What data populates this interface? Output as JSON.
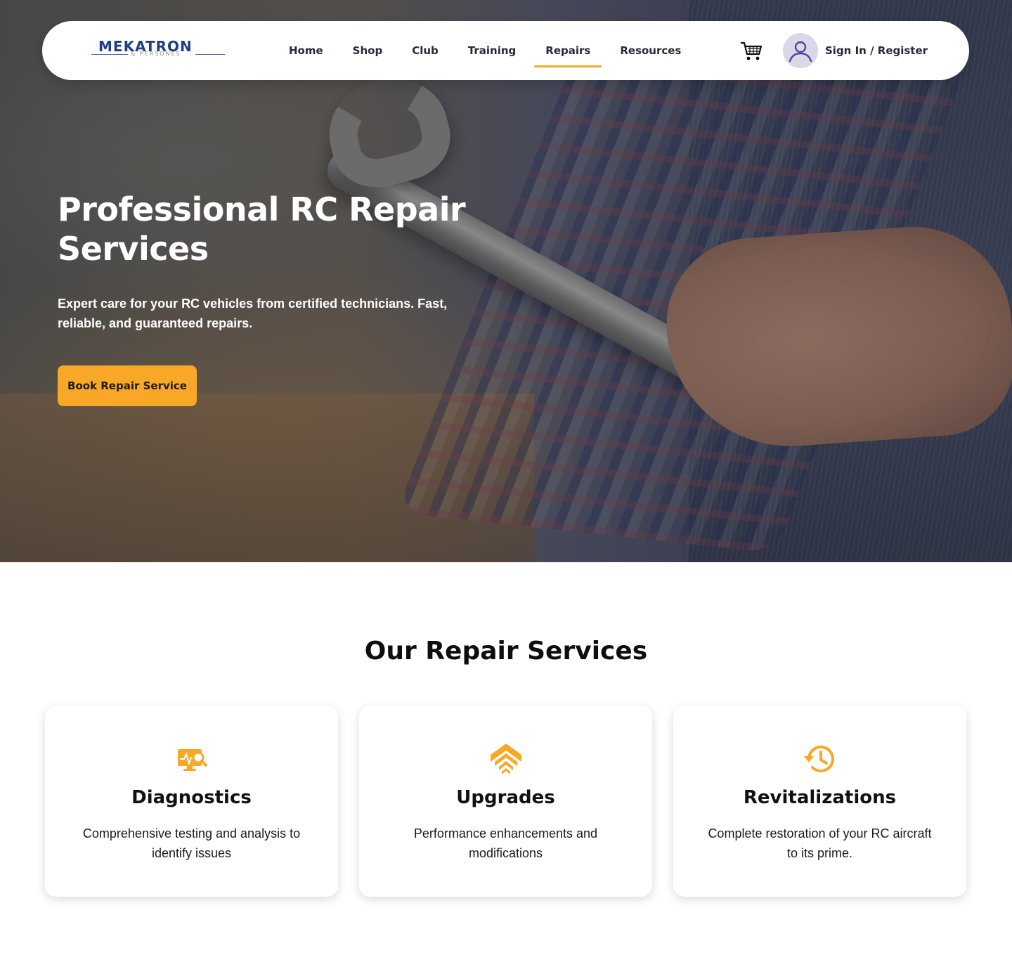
{
  "brand": {
    "name": "MEKATRON",
    "tagline": "& PERSONES"
  },
  "nav": {
    "links": [
      {
        "label": "Home"
      },
      {
        "label": "Shop"
      },
      {
        "label": "Club"
      },
      {
        "label": "Training"
      },
      {
        "label": "Repairs",
        "active": true
      },
      {
        "label": "Resources"
      }
    ],
    "signin_label": "Sign In / Register"
  },
  "hero": {
    "title": "Professional RC Repair Services",
    "subtitle": "Expert care for your RC vehicles from certified technicians. Fast, reliable, and guaranteed repairs.",
    "cta_label": "Book Repair Service"
  },
  "services": {
    "heading": "Our Repair Services",
    "items": [
      {
        "icon": "diagnostics-icon",
        "title": "Diagnostics",
        "description": "Comprehensive testing and analysis to identify issues"
      },
      {
        "icon": "upgrade-icon",
        "title": "Upgrades",
        "description": "Performance enhancements and modifications"
      },
      {
        "icon": "history-icon",
        "title": "Revitalizations",
        "description": "Complete restoration of your RC aircraft to its prime."
      }
    ]
  },
  "colors": {
    "accent": "#f8a826",
    "brand": "#1f3e86",
    "text": "#262a3a"
  }
}
